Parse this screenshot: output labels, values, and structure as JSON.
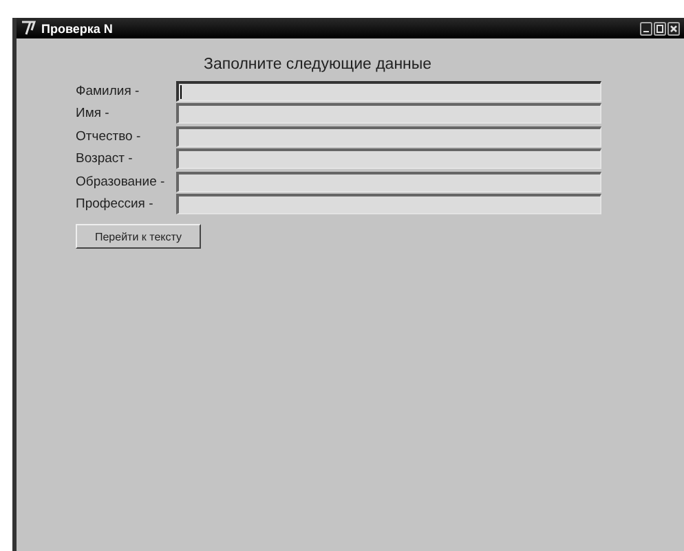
{
  "window": {
    "title": "Проверка N"
  },
  "heading": "Заполните следующие данные",
  "fields": [
    {
      "label": "Фамилия -",
      "focused": true
    },
    {
      "label": "Имя -",
      "focused": false
    },
    {
      "label": "Отчество -",
      "focused": false
    },
    {
      "label": "Возраст -",
      "focused": false
    },
    {
      "label": "Образование -",
      "focused": false
    },
    {
      "label": "Профессия -",
      "focused": false
    }
  ],
  "buttons": [
    {
      "label": "Перейти к тексту"
    }
  ]
}
